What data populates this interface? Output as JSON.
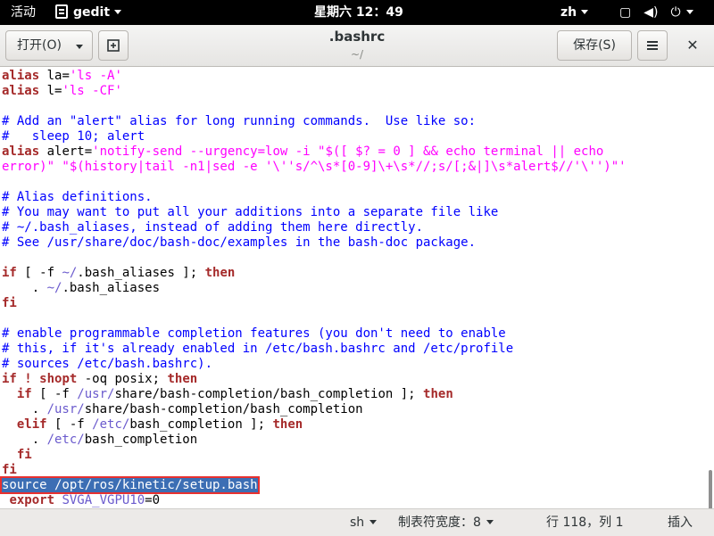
{
  "topbar": {
    "activities": "活动",
    "app_name": "gedit",
    "clock": "星期六 12：49",
    "input_lang": "zh"
  },
  "header": {
    "open_label": "打开(O)",
    "title": ".bashrc",
    "subtitle": "~/",
    "save_label": "保存(S)"
  },
  "editor": {
    "lines": [
      [
        {
          "t": "alias",
          "c": "kw"
        },
        {
          "t": " la=",
          "c": "txt"
        },
        {
          "t": "'ls -A'",
          "c": "str"
        }
      ],
      [
        {
          "t": "alias",
          "c": "kw"
        },
        {
          "t": " l=",
          "c": "txt"
        },
        {
          "t": "'ls -CF'",
          "c": "str"
        }
      ],
      [],
      [
        {
          "t": "# Add an \"alert\" alias for long running commands.  Use like so:",
          "c": "cmt"
        }
      ],
      [
        {
          "t": "#   sleep 10; alert",
          "c": "cmt"
        }
      ],
      [
        {
          "t": "alias",
          "c": "kw"
        },
        {
          "t": " alert=",
          "c": "txt"
        },
        {
          "t": "'notify-send --urgency=low -i \"$([ $? = 0 ] && echo terminal || echo",
          "c": "str"
        }
      ],
      [
        {
          "t": "error)\" \"$(history|tail -n1|sed -e '\\''s/^\\s*[0-9]\\+\\s*//;s/[;&|]\\s*alert$//'\\'')\"'",
          "c": "str"
        }
      ],
      [],
      [
        {
          "t": "# Alias definitions.",
          "c": "cmt"
        }
      ],
      [
        {
          "t": "# You may want to put all your additions into a separate file like",
          "c": "cmt"
        }
      ],
      [
        {
          "t": "# ~/.bash_aliases, instead of adding them here directly.",
          "c": "cmt"
        }
      ],
      [
        {
          "t": "# See /usr/share/doc/bash-doc/examples in the bash-doc package.",
          "c": "cmt"
        }
      ],
      [],
      [
        {
          "t": "if",
          "c": "kw"
        },
        {
          "t": " [ -f ",
          "c": "txt"
        },
        {
          "t": "~/",
          "c": "path"
        },
        {
          "t": ".bash_aliases ]; ",
          "c": "txt"
        },
        {
          "t": "then",
          "c": "kw"
        }
      ],
      [
        {
          "t": "    . ",
          "c": "txt"
        },
        {
          "t": "~/",
          "c": "path"
        },
        {
          "t": ".bash_aliases",
          "c": "txt"
        }
      ],
      [
        {
          "t": "fi",
          "c": "kw"
        }
      ],
      [],
      [
        {
          "t": "# enable programmable completion features (you don't need to enable",
          "c": "cmt"
        }
      ],
      [
        {
          "t": "# this, if it's already enabled in /etc/bash.bashrc and /etc/profile",
          "c": "cmt"
        }
      ],
      [
        {
          "t": "# sources /etc/bash.bashrc).",
          "c": "cmt"
        }
      ],
      [
        {
          "t": "if",
          "c": "kw"
        },
        {
          "t": " ",
          "c": "txt"
        },
        {
          "t": "!",
          "c": "kw"
        },
        {
          "t": " ",
          "c": "txt"
        },
        {
          "t": "shopt",
          "c": "kw"
        },
        {
          "t": " -oq posix; ",
          "c": "txt"
        },
        {
          "t": "then",
          "c": "kw"
        }
      ],
      [
        {
          "t": "  ",
          "c": "txt"
        },
        {
          "t": "if",
          "c": "kw"
        },
        {
          "t": " [ -f ",
          "c": "txt"
        },
        {
          "t": "/usr/",
          "c": "path"
        },
        {
          "t": "share/bash-completion/bash_completion ]; ",
          "c": "txt"
        },
        {
          "t": "then",
          "c": "kw"
        }
      ],
      [
        {
          "t": "    . ",
          "c": "txt"
        },
        {
          "t": "/usr/",
          "c": "path"
        },
        {
          "t": "share/bash-completion/bash_completion",
          "c": "txt"
        }
      ],
      [
        {
          "t": "  ",
          "c": "txt"
        },
        {
          "t": "elif",
          "c": "kw"
        },
        {
          "t": " [ -f ",
          "c": "txt"
        },
        {
          "t": "/etc/",
          "c": "path"
        },
        {
          "t": "bash_completion ]; ",
          "c": "txt"
        },
        {
          "t": "then",
          "c": "kw"
        }
      ],
      [
        {
          "t": "    . ",
          "c": "txt"
        },
        {
          "t": "/etc/",
          "c": "path"
        },
        {
          "t": "bash_completion",
          "c": "txt"
        }
      ],
      [
        {
          "t": "  ",
          "c": "txt"
        },
        {
          "t": "fi",
          "c": "kw"
        }
      ],
      [
        {
          "t": "fi",
          "c": "kw"
        }
      ],
      [
        {
          "t": "source /opt/ros/kinetic/setup.bash",
          "c": "hl"
        }
      ],
      [
        {
          "t": " ",
          "c": "txt"
        },
        {
          "t": "export",
          "c": "kw"
        },
        {
          "t": " ",
          "c": "txt"
        },
        {
          "t": "SVGA_VGPU10",
          "c": "var"
        },
        {
          "t": "=0",
          "c": "txt"
        }
      ]
    ]
  },
  "statusbar": {
    "language": "sh",
    "tab_width": "制表符宽度：8",
    "cursor": "行 118，列 1",
    "mode": "插入"
  },
  "colors": {
    "kw": "#a52a2a",
    "str": "#ff00ff",
    "cmt": "#0000ff",
    "path": "#6a5acd",
    "var": "#6a5acd",
    "txt": "#000000"
  }
}
